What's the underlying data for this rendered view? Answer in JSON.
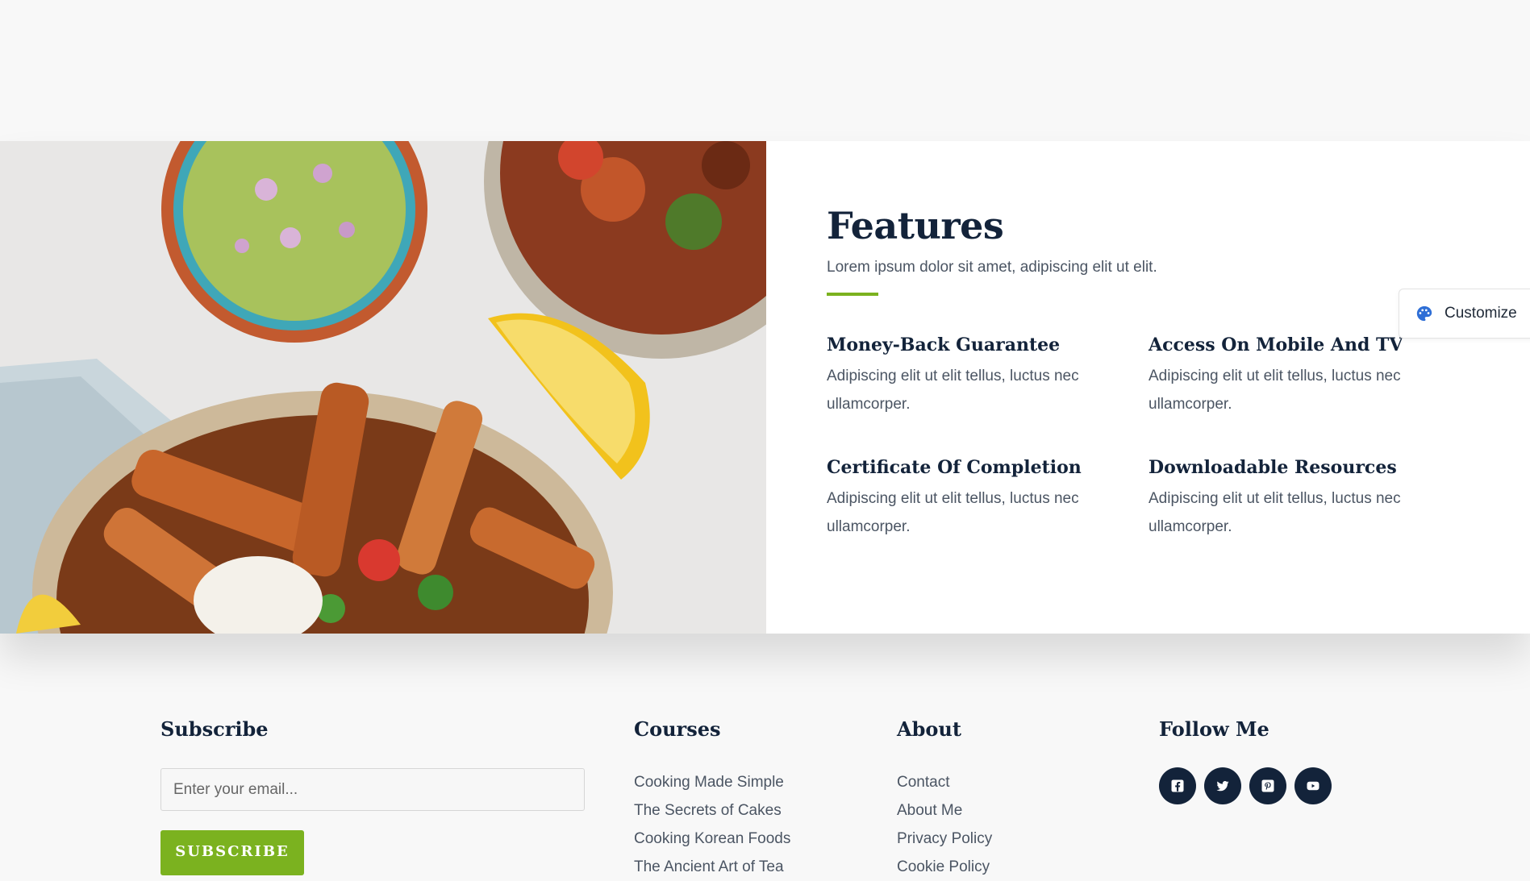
{
  "features": {
    "title": "Features",
    "subtitle": "Lorem ipsum dolor sit amet, adipiscing elit ut elit.",
    "accent_color": "#7bb21f",
    "items": [
      {
        "title": "Money-Back Guarantee",
        "text": "Adipiscing elit ut elit tellus, luctus nec ullamcorper."
      },
      {
        "title": "Access On Mobile And TV",
        "text": "Adipiscing elit ut elit tellus, luctus nec ullamcorper."
      },
      {
        "title": "Certificate Of Completion",
        "text": "Adipiscing elit ut elit tellus, luctus nec ullamcorper."
      },
      {
        "title": "Downloadable Resources",
        "text": "Adipiscing elit ut elit tellus, luctus nec ullamcorper."
      }
    ]
  },
  "customize": {
    "label": "Customize",
    "icon": "palette-icon"
  },
  "footer": {
    "subscribe": {
      "heading": "Subscribe",
      "email_placeholder": "Enter your email...",
      "button_label": "SUBSCRIBE"
    },
    "courses": {
      "heading": "Courses",
      "links": [
        "Cooking Made Simple",
        "The Secrets of Cakes",
        "Cooking Korean Foods",
        "The Ancient Art of Tea"
      ]
    },
    "about": {
      "heading": "About",
      "links": [
        "Contact",
        "About Me",
        "Privacy Policy",
        "Cookie Policy"
      ]
    },
    "follow": {
      "heading": "Follow Me",
      "icons": [
        "facebook-icon",
        "twitter-icon",
        "pinterest-icon",
        "youtube-icon"
      ],
      "icon_bg": "#13233a"
    }
  }
}
